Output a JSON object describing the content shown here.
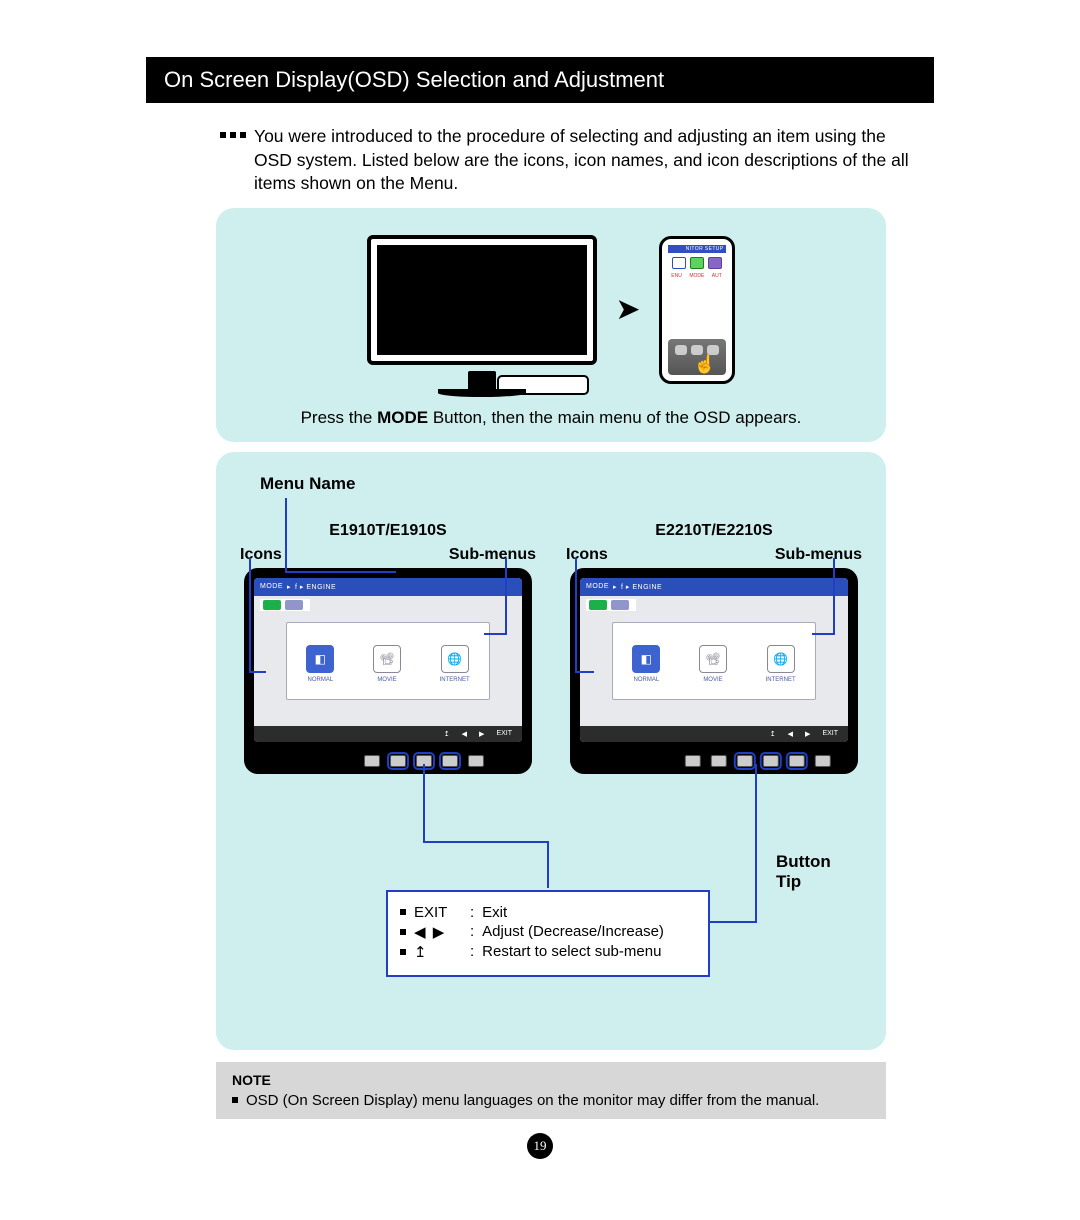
{
  "title": "On Screen Display(OSD) Selection and Adjustment",
  "intro": "You were introduced to the procedure of selecting and adjusting an item using the OSD system. Listed below are the icons, icon names, and icon descriptions of the all items shown on the Menu.",
  "panel1": {
    "caption_prefix": "Press the ",
    "caption_bold": "MODE",
    "caption_suffix": " Button, then the main menu of the OSD appears.",
    "zoom_header": "NITOR SETUP",
    "zoom_labels": {
      "a": "ENU",
      "b": "MODE",
      "c": "AUT"
    }
  },
  "panel2": {
    "menu_name": "Menu Name",
    "model_a": "E1910T/E1910S",
    "model_b": "E2210T/E2210S",
    "hdr_icons": "Icons",
    "hdr_submenus": "Sub-menus",
    "osd_title_a": "MODE",
    "osd_title_b": "f ▸ ENGINE",
    "osd_ic_labels": {
      "a": "NORMAL",
      "b": "MOVIE",
      "c": "INTERNET"
    },
    "osd_footer": {
      "a": "↥",
      "b": "◀",
      "c": "▶",
      "d": "EXIT"
    },
    "button_tip": {
      "label_l1": "Button",
      "label_l2": "Tip"
    },
    "tips": {
      "exit_key": "EXIT",
      "exit_text": "Exit",
      "arrows_key": "◀  ▶",
      "arrows_text": "Adjust (Decrease/Increase)",
      "restart_key": "↥",
      "restart_text": "Restart to select sub-menu"
    }
  },
  "note": {
    "heading": "NOTE",
    "text": "OSD (On Screen Display) menu languages on the monitor may differ from the manual."
  },
  "page_number": "19",
  "colon": ":"
}
